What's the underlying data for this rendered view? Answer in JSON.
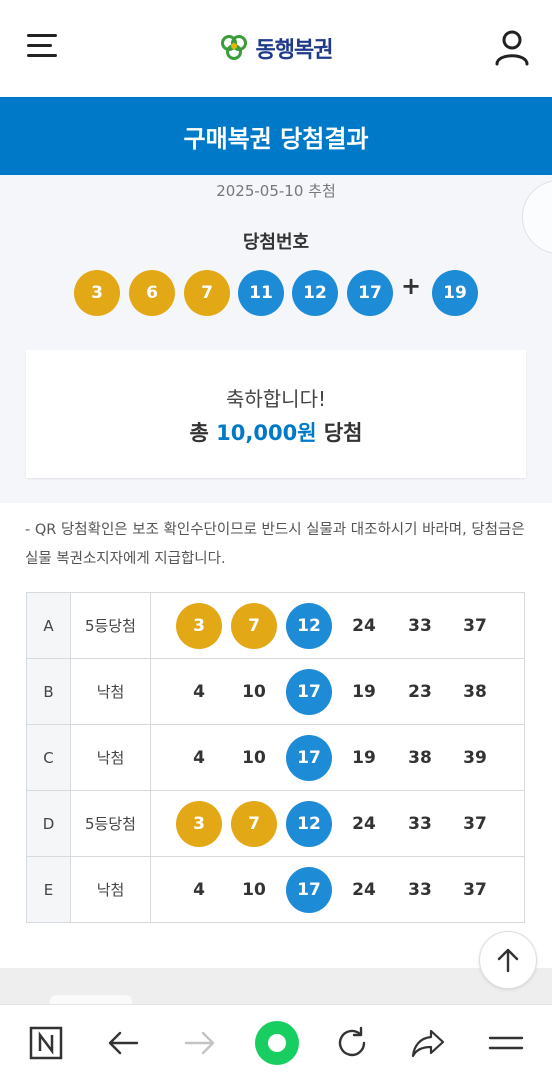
{
  "header": {
    "logo_text": "동행복권",
    "icons": {
      "menu": "hamburger-menu-icon",
      "logo": "clover-logo-icon",
      "user": "user-icon"
    }
  },
  "title": "구매복권 당첨결과",
  "draw": {
    "date": "2025-05-10 추첨",
    "winning_label": "당첨번호",
    "numbers": [
      3,
      6,
      7,
      11,
      12,
      17
    ],
    "plus": "+",
    "bonus": 19
  },
  "result": {
    "congrats": "축하합니다!",
    "prefix": "총",
    "amount": "10,000원",
    "suffix": "당첨"
  },
  "notice": "- QR 당첨확인은 보조 확인수단이므로 반드시 실물과 대조하시기 바라며, 당첨금은 실물 복권소지자에게 지급합니다.",
  "tickets": [
    {
      "letter": "A",
      "status": "5등당첨",
      "numbers": [
        "3",
        "7",
        "12",
        "24",
        "33",
        "37"
      ],
      "highlight": [
        "y",
        "y",
        "b",
        "",
        "",
        ""
      ]
    },
    {
      "letter": "B",
      "status": "낙첨",
      "numbers": [
        "4",
        "10",
        "17",
        "19",
        "23",
        "38"
      ],
      "highlight": [
        "",
        "",
        "b",
        "",
        "",
        ""
      ]
    },
    {
      "letter": "C",
      "status": "낙첨",
      "numbers": [
        "4",
        "10",
        "17",
        "19",
        "38",
        "39"
      ],
      "highlight": [
        "",
        "",
        "b",
        "",
        "",
        ""
      ]
    },
    {
      "letter": "D",
      "status": "5등당첨",
      "numbers": [
        "3",
        "7",
        "12",
        "24",
        "33",
        "37"
      ],
      "highlight": [
        "y",
        "y",
        "b",
        "",
        "",
        ""
      ]
    },
    {
      "letter": "E",
      "status": "낙첨",
      "numbers": [
        "4",
        "10",
        "17",
        "24",
        "33",
        "37"
      ],
      "highlight": [
        "",
        "",
        "b",
        "",
        "",
        ""
      ]
    }
  ],
  "colors": {
    "brand_blue": "#0079c8",
    "ball_yellow": "#e3a816",
    "ball_blue": "#1e8bd6"
  },
  "browser_bar": {
    "icons": [
      "naver-n-icon",
      "back-arrow-icon",
      "forward-arrow-icon",
      "home-green-dot-icon",
      "refresh-icon",
      "share-icon",
      "menu-icon"
    ]
  }
}
